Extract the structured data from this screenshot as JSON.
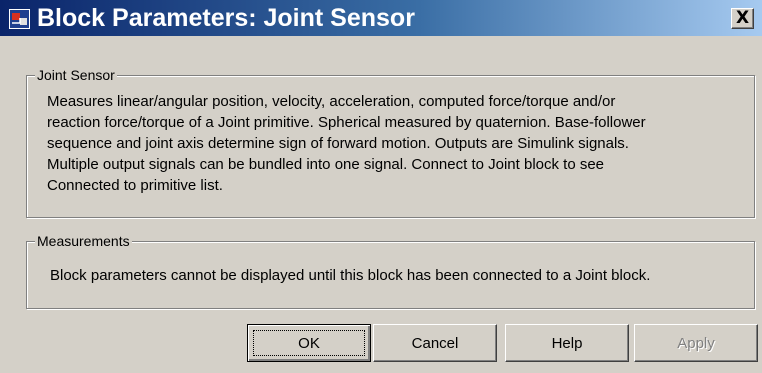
{
  "window": {
    "title": "Block Parameters: Joint Sensor",
    "icon": "simulink-block-icon",
    "close_label": "X"
  },
  "joint_sensor_group": {
    "legend": "Joint Sensor",
    "description_lines": [
      "Measures linear/angular position, velocity, acceleration, computed force/torque and/or",
      "reaction force/torque of a Joint primitive. Spherical measured by quaternion. Base-follower",
      "sequence and joint axis determine sign of forward motion. Outputs are Simulink signals.",
      "Multiple output signals can be bundled into one signal. Connect to Joint block to see",
      "Connected to primitive list."
    ]
  },
  "measurements_group": {
    "legend": "Measurements",
    "message": "Block parameters cannot be displayed until this block has been connected to a Joint block."
  },
  "buttons": {
    "ok": "OK",
    "cancel": "Cancel",
    "help": "Help",
    "apply": "Apply"
  },
  "colors": {
    "face": "#d4d0c8",
    "title_start": "#0a246a",
    "title_end": "#a6caf0",
    "disabled_text": "#808080"
  }
}
